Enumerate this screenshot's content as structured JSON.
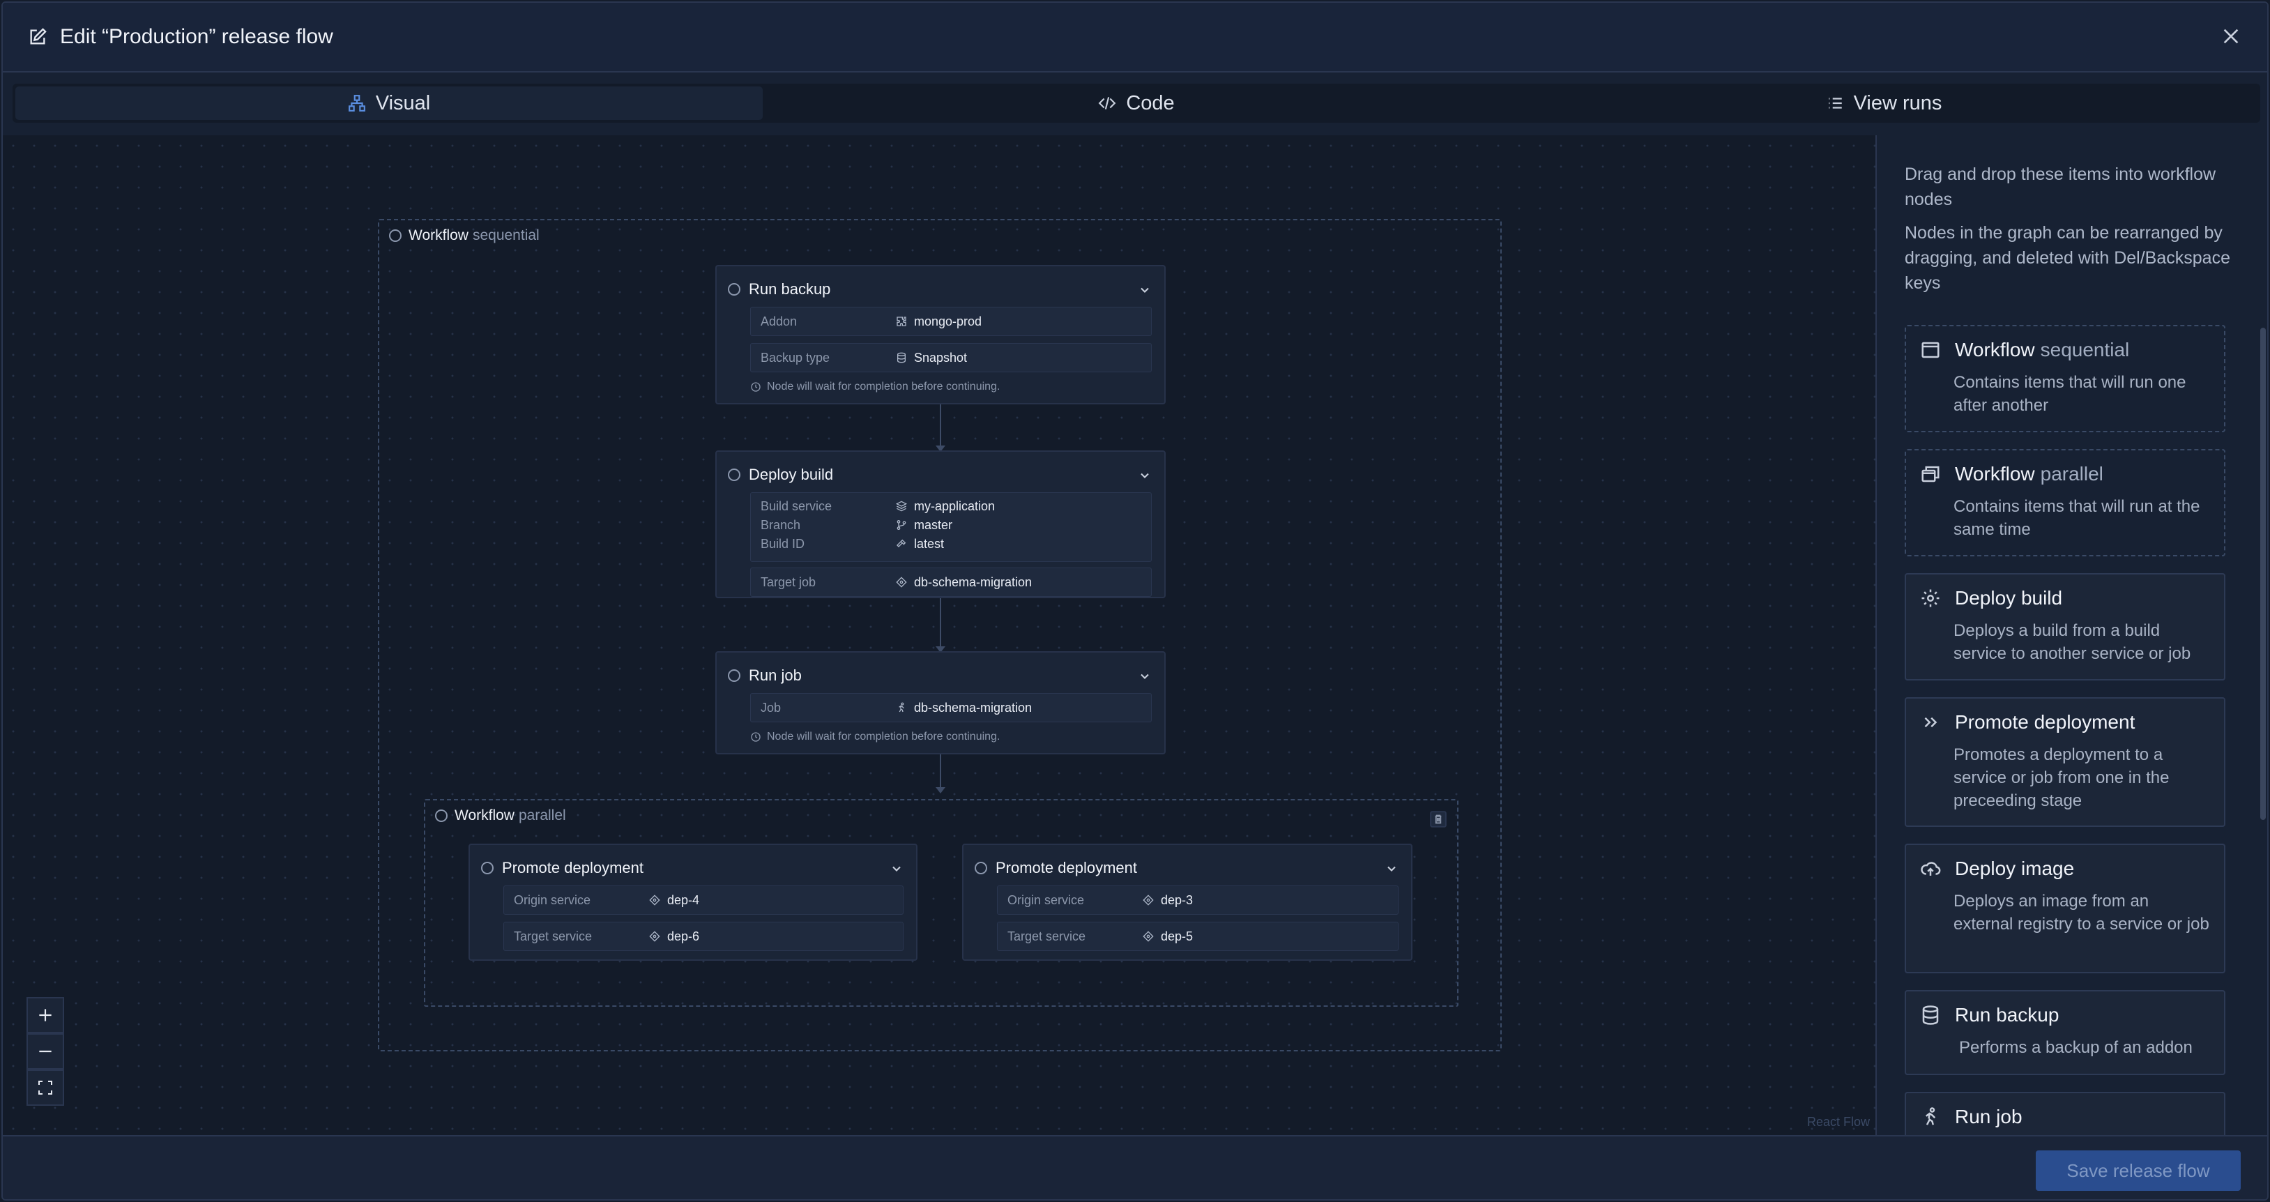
{
  "header": {
    "title": "Edit “Production” release flow"
  },
  "tabs": [
    {
      "label": "Visual",
      "icon": "sitemap-icon",
      "active": true
    },
    {
      "label": "Code",
      "icon": "code-icon",
      "active": false
    },
    {
      "label": "View runs",
      "icon": "list-icon",
      "active": false
    }
  ],
  "canvas": {
    "root": {
      "name": "Workflow",
      "kind": "sequential"
    },
    "run_backup": {
      "title": "Run backup",
      "addon_label": "Addon",
      "addon_value": "mongo-prod",
      "type_label": "Backup type",
      "type_value": "Snapshot",
      "note": "Node will wait for completion before continuing."
    },
    "deploy_build": {
      "title": "Deploy build",
      "service_label": "Build service",
      "service_value": "my-application",
      "branch_label": "Branch",
      "branch_value": "master",
      "build_label": "Build ID",
      "build_value": "latest",
      "target_label": "Target job",
      "target_value": "db-schema-migration"
    },
    "run_job": {
      "title": "Run job",
      "job_label": "Job",
      "job_value": "db-schema-migration",
      "note": "Node will wait for completion before continuing."
    },
    "parallel": {
      "name": "Workflow",
      "kind": "parallel"
    },
    "promote_left": {
      "title": "Promote deployment",
      "origin_label": "Origin service",
      "origin_value": "dep-4",
      "target_label": "Target service",
      "target_value": "dep-6"
    },
    "promote_right": {
      "title": "Promote deployment",
      "origin_label": "Origin service",
      "origin_value": "dep-3",
      "target_label": "Target service",
      "target_value": "dep-5"
    },
    "attribution": "React Flow"
  },
  "sidebar": {
    "intro_1": "Drag and drop these items into workflow nodes",
    "intro_2": "Nodes in the graph can be rearranged by dragging, and deleted with Del/Backspace keys",
    "items": [
      {
        "title": "Workflow",
        "kind": "sequential",
        "desc": "Contains items that will run one after another"
      },
      {
        "title": "Workflow",
        "kind": "parallel",
        "desc": "Contains items that will run at the same time"
      },
      {
        "title": "Deploy build",
        "desc": "Deploys a build from a build service to another service or job"
      },
      {
        "title": "Promote deployment",
        "desc": "Promotes a deployment to a service or job from one in the preceeding stage"
      },
      {
        "title": "Deploy image",
        "desc": "Deploys an image from an external registry to a service or job"
      },
      {
        "title": "Run backup",
        "desc": "Performs a backup of an addon"
      },
      {
        "title": "Run job"
      }
    ]
  },
  "footer": {
    "save_label": "Save release flow"
  },
  "colors": {
    "accent": "#2a4d8f",
    "tab_icon_active": "#5a8ee0"
  }
}
